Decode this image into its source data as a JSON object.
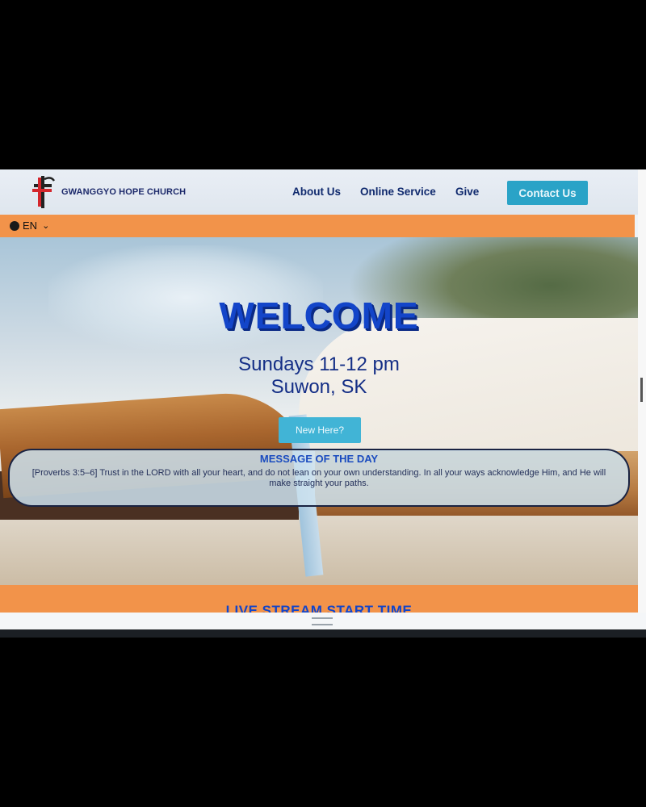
{
  "header": {
    "brand_name": "GWANGGYO HOPE CHURCH",
    "nav": {
      "about": "About Us",
      "online_service": "Online Service",
      "give": "Give"
    },
    "contact_button": "Contact Us"
  },
  "language": {
    "current": "EN",
    "icon": "globe-icon"
  },
  "hero": {
    "title": "WELCOME",
    "schedule": "Sundays 11-12 pm",
    "location": "Suwon, SK",
    "cta": "New Here?"
  },
  "message_of_day": {
    "title": "MESSAGE OF THE DAY",
    "text": "[Proverbs 3:5–6] Trust in the LORD with all your heart, and do not lean on your own understanding. In all your ways acknowledge Him, and He will make straight your paths."
  },
  "next_section": {
    "title": "LIVE STREAM START TIME"
  },
  "colors": {
    "accent_orange": "#f2934a",
    "button_teal": "#2aa3c7",
    "title_blue": "#1345c9",
    "logo_red": "#d4262c"
  }
}
